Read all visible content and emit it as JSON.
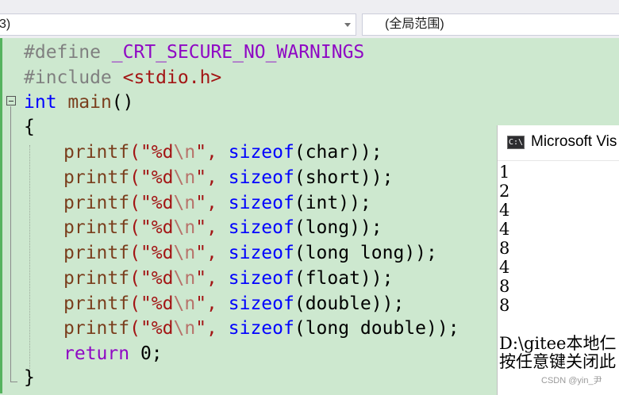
{
  "navbar": {
    "scope_combo": "3)",
    "member_combo": "(全局范围)"
  },
  "code": {
    "line1": {
      "pp": "#define",
      "name": "_CRT_SECURE_NO_WARNINGS"
    },
    "line2": {
      "pp": "#include",
      "header": "<stdio.h>"
    },
    "line3": {
      "type": "int",
      "fname": "main",
      "parens": "()"
    },
    "line4": {
      "brace": "{"
    },
    "printf_lines": [
      {
        "fn": "printf",
        "q1": "(\"",
        "fmt": "%d",
        "esc": "\\n",
        "q2": "\", ",
        "kw": "sizeof",
        "arg": "(char));"
      },
      {
        "fn": "printf",
        "q1": "(\"",
        "fmt": "%d",
        "esc": "\\n",
        "q2": "\", ",
        "kw": "sizeof",
        "arg": "(short));"
      },
      {
        "fn": "printf",
        "q1": "(\"",
        "fmt": "%d",
        "esc": "\\n",
        "q2": "\", ",
        "kw": "sizeof",
        "arg": "(int));"
      },
      {
        "fn": "printf",
        "q1": "(\"",
        "fmt": "%d",
        "esc": "\\n",
        "q2": "\", ",
        "kw": "sizeof",
        "arg": "(long));"
      },
      {
        "fn": "printf",
        "q1": "(\"",
        "fmt": "%d",
        "esc": "\\n",
        "q2": "\", ",
        "kw": "sizeof",
        "arg": "(long long));"
      },
      {
        "fn": "printf",
        "q1": "(\"",
        "fmt": "%d",
        "esc": "\\n",
        "q2": "\", ",
        "kw": "sizeof",
        "arg": "(float));"
      },
      {
        "fn": "printf",
        "q1": "(\"",
        "fmt": "%d",
        "esc": "\\n",
        "q2": "\", ",
        "kw": "sizeof",
        "arg": "(double));"
      },
      {
        "fn": "printf",
        "q1": "(\"",
        "fmt": "%d",
        "esc": "\\n",
        "q2": "\", ",
        "kw": "sizeof",
        "arg": "(long double));"
      }
    ],
    "return_line": {
      "kw": "return",
      "val": " 0;"
    },
    "close_brace": "}"
  },
  "console": {
    "icon_text": "C:\\",
    "title": "Microsoft Vis",
    "output": [
      "1",
      "2",
      "4",
      "4",
      "8",
      "4",
      "8",
      "8"
    ],
    "path_line": "D:\\gitee本地仁",
    "prompt_line": "按任意键关闭此"
  },
  "watermark": "CSDN @yin_尹",
  "colors": {
    "editor_bg": "#cde8cf",
    "keyword": "#0000ff",
    "function": "#7a3e1d",
    "string": "#a31515",
    "preprocessor": "#808080",
    "control": "#8f08c4"
  }
}
